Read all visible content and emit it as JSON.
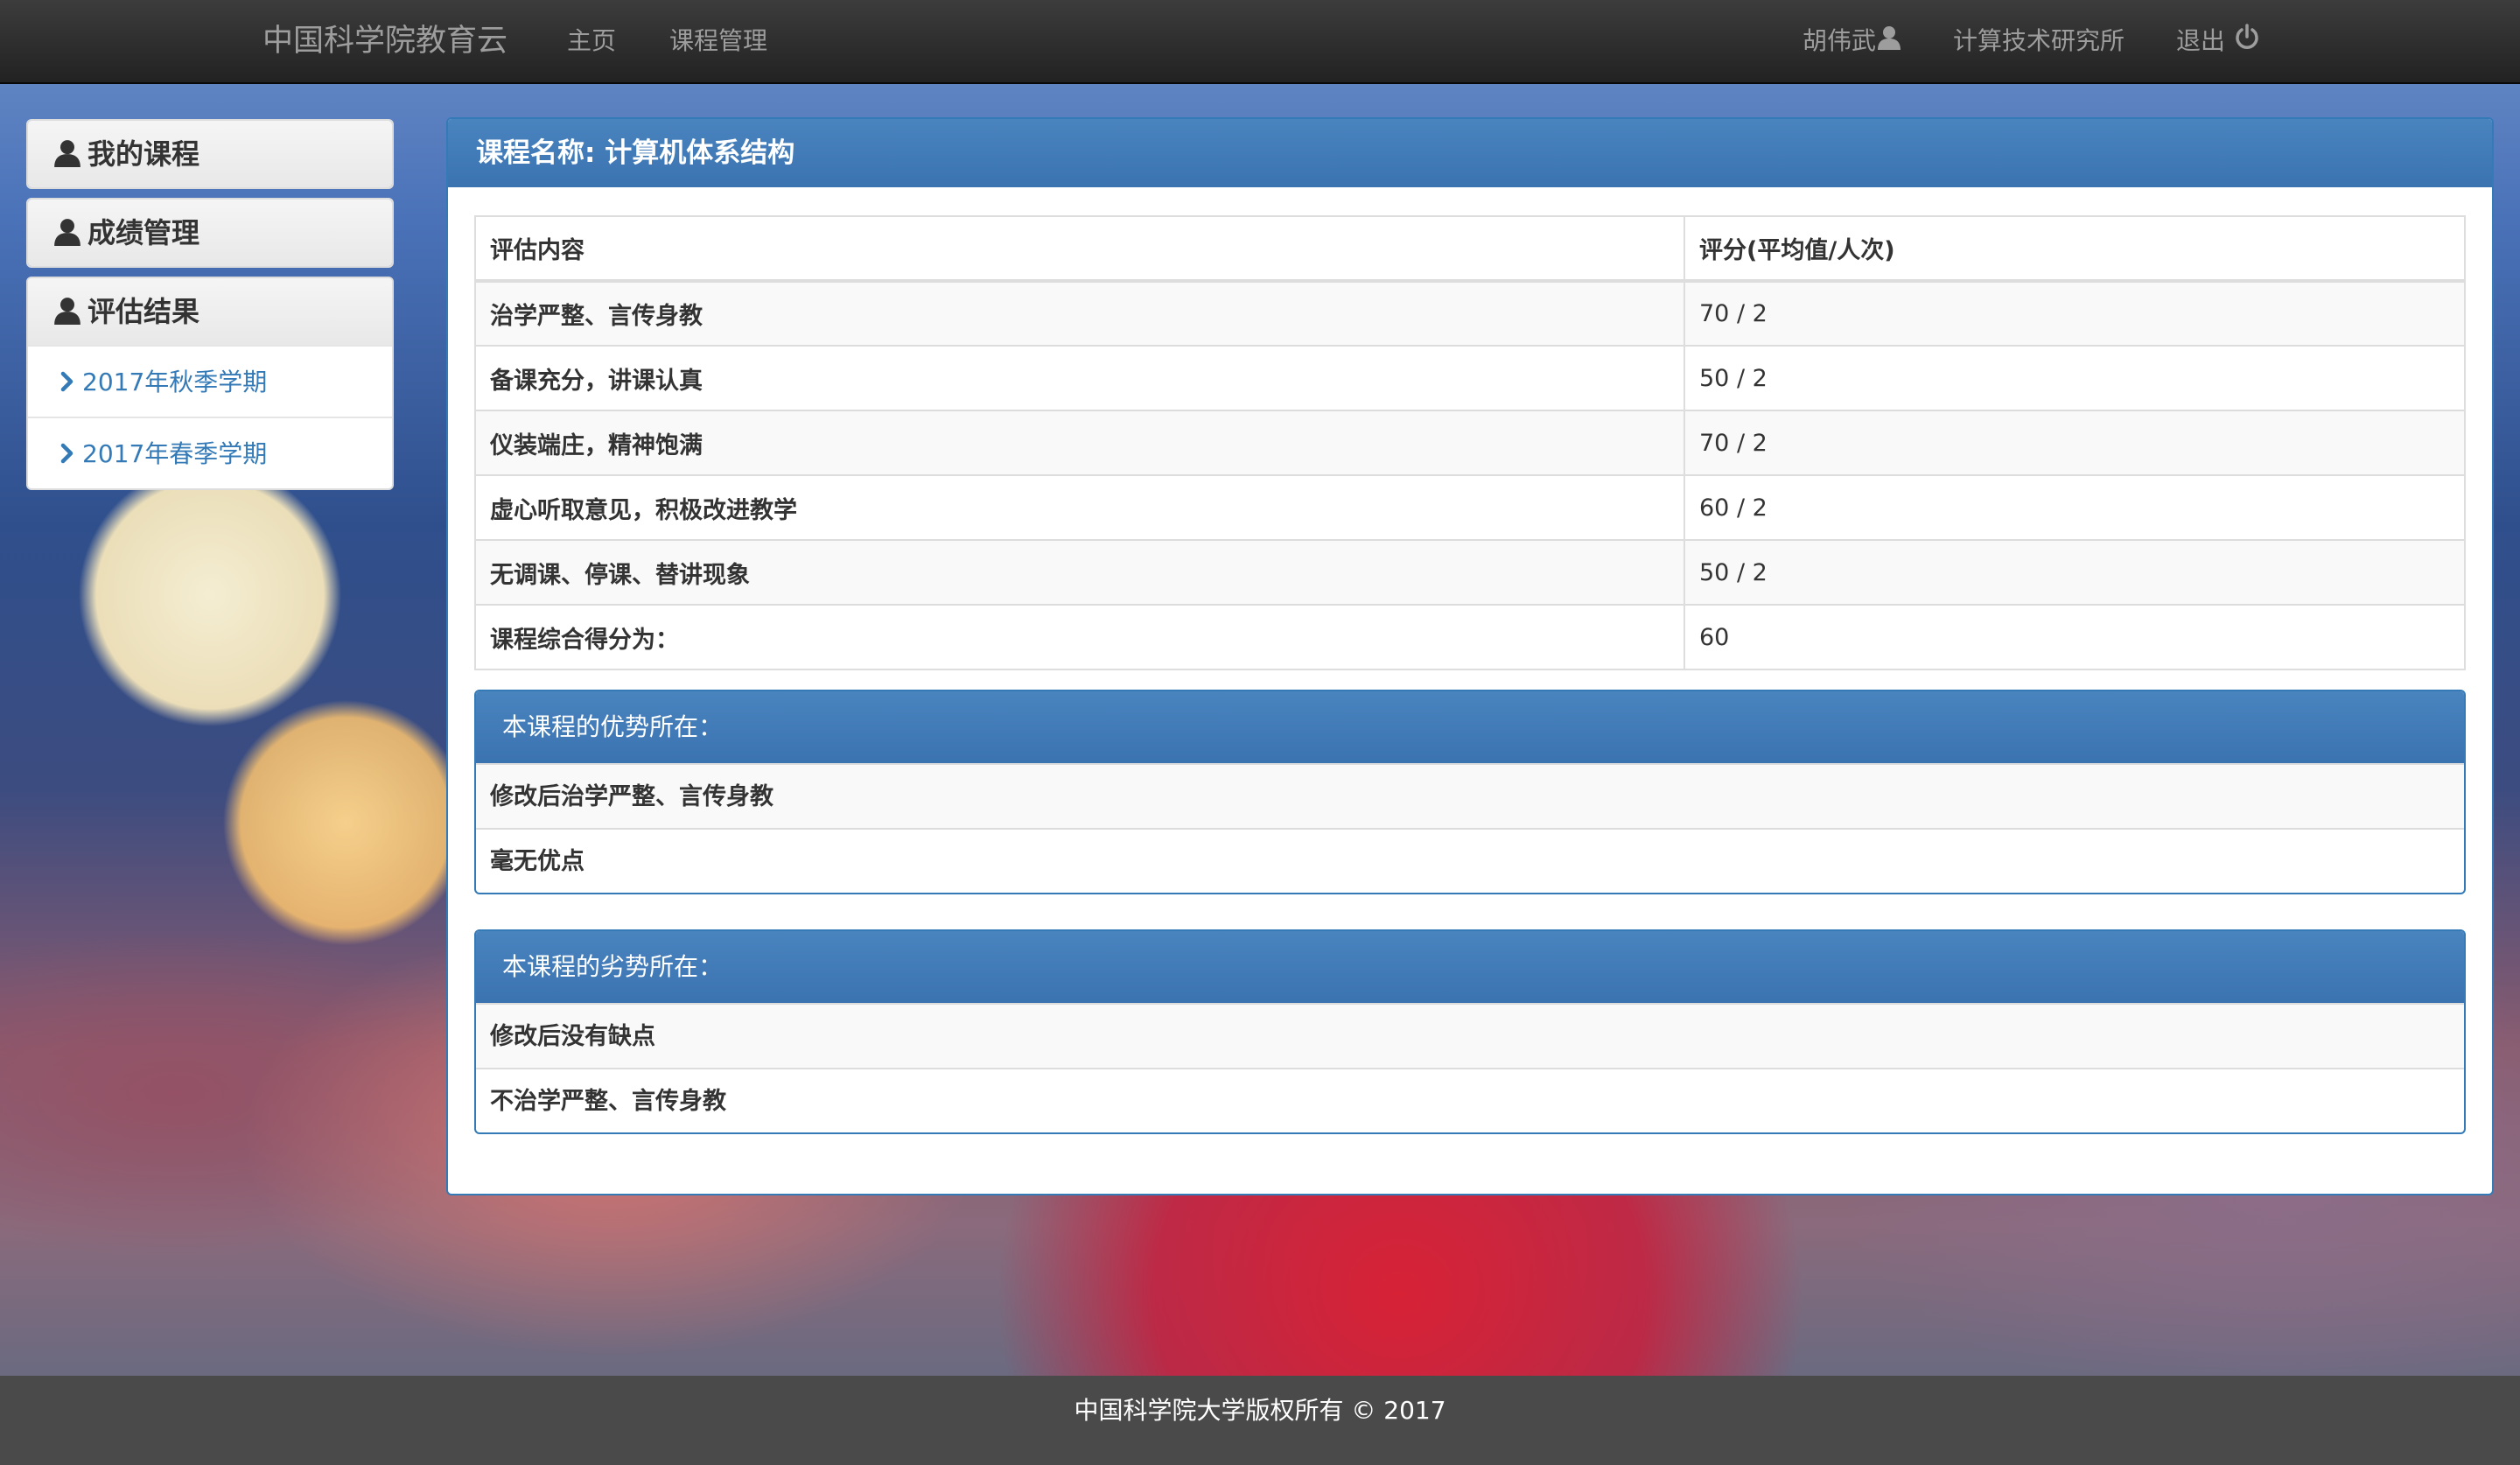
{
  "navbar": {
    "brand": "中国科学院教育云",
    "links": [
      "主页",
      "课程管理"
    ],
    "user": "胡伟武",
    "institute": "计算技术研究所",
    "logout": "退出"
  },
  "sidebar": {
    "panels": [
      {
        "label": "我的课程",
        "icon": "user-icon"
      },
      {
        "label": "成绩管理",
        "icon": "user-icon"
      },
      {
        "label": "评估结果",
        "icon": "user-icon",
        "items": [
          "2017年秋季学期",
          "2017年春季学期"
        ]
      }
    ]
  },
  "main": {
    "title": "课程名称: 计算机体系结构",
    "table": {
      "headers": [
        "评估内容",
        "评分(平均值/人次)"
      ],
      "rows": [
        [
          "治学严整、言传身教",
          "70 / 2"
        ],
        [
          "备课充分，讲课认真",
          "50 / 2"
        ],
        [
          "仪装端庄，精神饱满",
          "70 / 2"
        ],
        [
          "虚心听取意见，积极改进教学",
          "60 / 2"
        ],
        [
          "无调课、停课、替讲现象",
          "50 / 2"
        ],
        [
          "课程综合得分为：",
          "60"
        ]
      ]
    },
    "strengths": {
      "title": "本课程的优势所在：",
      "items": [
        "修改后治学严整、言传身教",
        "毫无优点"
      ]
    },
    "weaknesses": {
      "title": "本课程的劣势所在：",
      "items": [
        "修改后没有缺点",
        "不治学严整、言传身教"
      ]
    }
  },
  "footer": {
    "text": "中国科学院大学版权所有 © 2017"
  },
  "colors": {
    "primary": "#337ab7",
    "navbar": "#222222",
    "footer": "#4a4a4a"
  }
}
